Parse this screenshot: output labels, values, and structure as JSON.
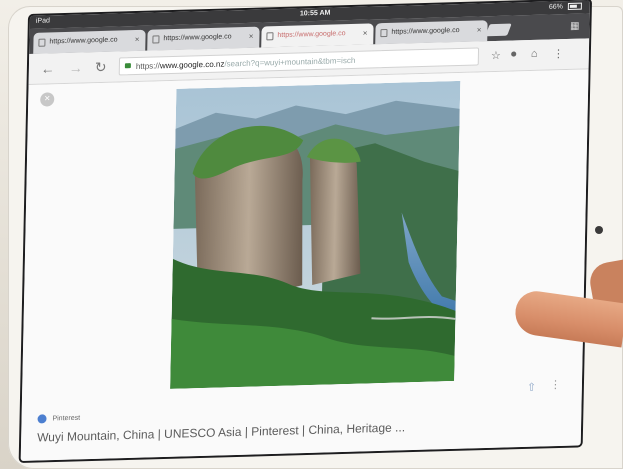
{
  "status_bar": {
    "device": "iPad",
    "time": "10:55 AM",
    "battery": "66%"
  },
  "tabs": [
    {
      "label": "https://www.google.co",
      "active": false
    },
    {
      "label": "https://www.google.co",
      "active": false
    },
    {
      "label": "https://www.google.co",
      "active": true
    },
    {
      "label": "https://www.google.co",
      "active": false
    }
  ],
  "toolbar": {
    "url_scheme": "https://",
    "url_host": "www.google.co.nz",
    "url_rest": "/search?q=wuyi+mountain&tbm=isch"
  },
  "result": {
    "source": "Pinterest",
    "caption": "Wuyi Mountain, China | UNESCO Asia | Pinterest | China, Heritage ..."
  },
  "colors": {
    "status_bar": "#3a3a3c",
    "tab_strip": "#4a4a4d",
    "active_tab_text": "#c76b6b",
    "secure_lock": "#3a8c3a"
  }
}
